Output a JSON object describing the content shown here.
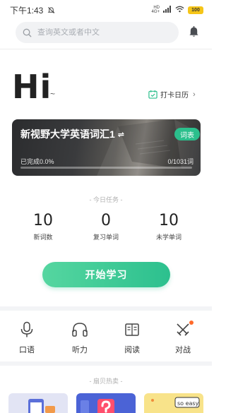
{
  "status_bar": {
    "time": "下午1:43",
    "network": "4G+",
    "signal_label": "HD",
    "battery": "100"
  },
  "search": {
    "placeholder": "查询英文或者中文"
  },
  "greeting": {
    "text": "Hi",
    "tilde": "~"
  },
  "checkin": {
    "label": "打卡日历",
    "chevron": "›"
  },
  "book_card": {
    "title": "新视野大学英语词汇1",
    "swap_symbol": "⇌",
    "vocab_button": "词表",
    "completed_label": "已完成0.0%",
    "progress_count": "0/1031词",
    "progress_fraction": 0.0
  },
  "today_tasks": {
    "heading": "- 今日任务 -",
    "stats": [
      {
        "value": "10",
        "label": "新词数"
      },
      {
        "value": "0",
        "label": "复习单词"
      },
      {
        "value": "10",
        "label": "未学单词"
      }
    ]
  },
  "start_button": {
    "label": "开始学习"
  },
  "shortcuts": [
    {
      "label": "口语",
      "icon": "microphone-icon"
    },
    {
      "label": "听力",
      "icon": "headphones-icon"
    },
    {
      "label": "阅读",
      "icon": "book-icon"
    },
    {
      "label": "对战",
      "icon": "crossed-swords-icon"
    }
  ],
  "hot_picks": {
    "heading": "- 扇贝热卖 -",
    "thumbnail_text": "so easy"
  },
  "colors": {
    "accent": "#2bbf8c",
    "accent_light": "#55d6a0",
    "badge": "#ff6a2b",
    "battery": "#f5c518"
  }
}
